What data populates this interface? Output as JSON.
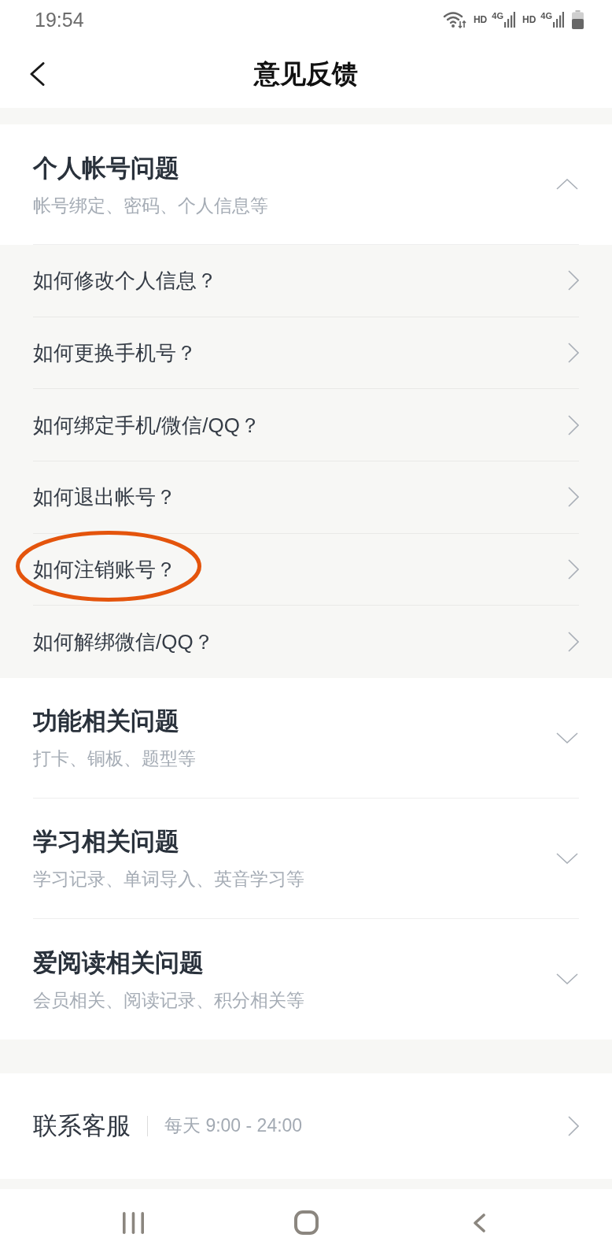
{
  "status_bar": {
    "time": "19:54",
    "networks": [
      {
        "hd": "HD",
        "type": "4G"
      },
      {
        "hd": "HD",
        "type": "4G"
      }
    ]
  },
  "header": {
    "title": "意见反馈"
  },
  "sections": [
    {
      "title": "个人帐号问题",
      "subtitle": "帐号绑定、密码、个人信息等",
      "expanded": true,
      "items": [
        {
          "label": "如何修改个人信息？",
          "highlighted": false
        },
        {
          "label": "如何更换手机号？",
          "highlighted": false
        },
        {
          "label": "如何绑定手机/微信/QQ？",
          "highlighted": false
        },
        {
          "label": "如何退出帐号？",
          "highlighted": false
        },
        {
          "label": "如何注销账号？",
          "highlighted": true
        },
        {
          "label": "如何解绑微信/QQ？",
          "highlighted": false
        }
      ]
    },
    {
      "title": "功能相关问题",
      "subtitle": "打卡、铜板、题型等",
      "expanded": false
    },
    {
      "title": "学习相关问题",
      "subtitle": "学习记录、单词导入、英音学习等",
      "expanded": false
    },
    {
      "title": "爱阅读相关问题",
      "subtitle": "会员相关、阅读记录、积分相关等",
      "expanded": false
    }
  ],
  "contact": {
    "label": "联系客服",
    "hours": "每天 9:00 - 24:00"
  }
}
